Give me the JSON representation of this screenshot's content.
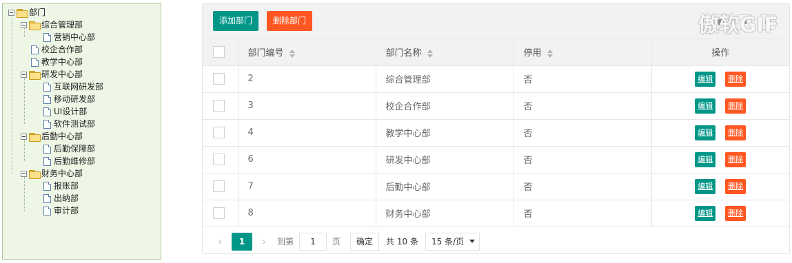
{
  "tree": {
    "root": "部门",
    "nodes": [
      "综合管理部",
      "营销中心部",
      "校企合作部",
      "教学中心部",
      "研发中心部",
      "互联网研发部",
      "移动研发部",
      "UI设计部",
      "软件测试部",
      "后勤中心部",
      "后勤保障部",
      "后勤维修部",
      "财务中心部",
      "报账部",
      "出纳部",
      "审计部"
    ]
  },
  "toolbar": {
    "add_label": "添加部门",
    "delete_label": "删除部门",
    "watermark": "傲软GIF"
  },
  "table": {
    "headers": {
      "id": "部门编号",
      "name": "部门名称",
      "disabled": "停用",
      "ops": "操作"
    },
    "rows": [
      {
        "id": "2",
        "name": "综合管理部",
        "disabled": "否"
      },
      {
        "id": "3",
        "name": "校企合作部",
        "disabled": "否"
      },
      {
        "id": "4",
        "name": "教学中心部",
        "disabled": "否"
      },
      {
        "id": "6",
        "name": "研发中心部",
        "disabled": "否"
      },
      {
        "id": "7",
        "name": "后勤中心部",
        "disabled": "否"
      },
      {
        "id": "8",
        "name": "财务中心部",
        "disabled": "否"
      }
    ],
    "edit_label": "编辑",
    "delete_label": "删除"
  },
  "pager": {
    "current": "1",
    "goto_prefix": "到第",
    "goto_value": "1",
    "goto_suffix": "页",
    "confirm": "确定",
    "total": "共 10 条",
    "page_size": "15 条/页"
  },
  "colors": {
    "accent": "#009688",
    "danger": "#ff5722"
  }
}
